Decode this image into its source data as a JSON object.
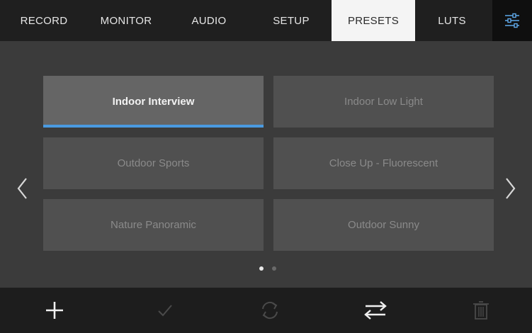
{
  "tabs": [
    {
      "label": "RECORD"
    },
    {
      "label": "MONITOR"
    },
    {
      "label": "AUDIO"
    },
    {
      "label": "SETUP"
    },
    {
      "label": "PRESETS",
      "active": true
    },
    {
      "label": "LUTS"
    }
  ],
  "settings_icon": "sliders-icon",
  "presets": [
    {
      "label": "Indoor Interview",
      "selected": true
    },
    {
      "label": "Indoor Low Light"
    },
    {
      "label": "Outdoor Sports"
    },
    {
      "label": "Close Up - Fluorescent"
    },
    {
      "label": "Nature Panoramic"
    },
    {
      "label": "Outdoor Sunny"
    }
  ],
  "pagination": {
    "current_page": 1,
    "total_pages": 2
  },
  "toolbar": {
    "icons": [
      "plus-icon",
      "check-icon",
      "sync-icon",
      "swap-arrows-icon",
      "trash-icon"
    ]
  },
  "colors": {
    "accent": "#4a9ae0",
    "active_tab_bg": "#f4f4f4",
    "tab_bar_bg": "#1f1f1f",
    "background": "#3b3b3b"
  }
}
